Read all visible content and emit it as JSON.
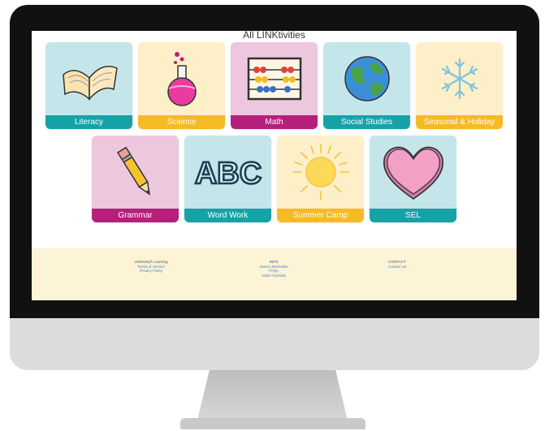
{
  "page": {
    "title": "All LINKtivities"
  },
  "tiles": [
    {
      "label": "Literacy",
      "icon": "open-book-icon"
    },
    {
      "label": "Science",
      "icon": "flask-icon"
    },
    {
      "label": "Math",
      "icon": "abacus-icon"
    },
    {
      "label": "Social Studies",
      "icon": "globe-icon"
    },
    {
      "label": "Seasonal & Holiday",
      "icon": "snowflake-icon"
    },
    {
      "label": "Grammar",
      "icon": "pencil-icon"
    },
    {
      "label": "Word Work",
      "icon": "abc-letters-icon"
    },
    {
      "label": "Summer Camp",
      "icon": "sun-icon"
    },
    {
      "label": "SEL",
      "icon": "heart-icon"
    }
  ],
  "abc_text": "ABC",
  "footer": {
    "col1": {
      "heading": "LINKtivity® Learning",
      "links": [
        "Terms of Service",
        "Privacy Policy"
      ]
    },
    "col2": {
      "heading": "INFO",
      "links": [
        "About LINKtivities",
        "FAQs",
        "Video Tutorials"
      ]
    },
    "col3": {
      "heading": "CONTACT",
      "links": [
        "Contact Us"
      ]
    }
  },
  "colors": {
    "tile_blue": "#c4e6ea",
    "tile_yellow": "#fdefc8",
    "tile_pink": "#ecc7dd",
    "label_teal": "#17a2a8",
    "label_gold": "#f6ba25",
    "label_magenta": "#b4207b",
    "footer_bg": "#fdf3d6"
  }
}
